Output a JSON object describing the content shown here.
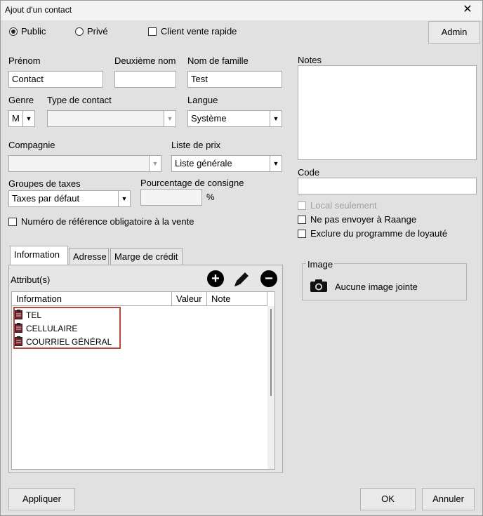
{
  "window": {
    "title": "Ajout d'un contact",
    "close_glyph": "✕"
  },
  "top": {
    "radio_public": "Public",
    "radio_prive": "Privé",
    "client_rapide": "Client vente rapide",
    "admin_button": "Admin"
  },
  "fields": {
    "prenom_label": "Prénom",
    "prenom_value": "Contact",
    "deuxieme_label": "Deuxième nom",
    "deuxieme_value": "",
    "nom_label": "Nom de famille",
    "nom_value": "Test",
    "genre_label": "Genre",
    "genre_value": "M",
    "type_label": "Type de contact",
    "type_value": "",
    "langue_label": "Langue",
    "langue_value": "Système",
    "compagnie_label": "Compagnie",
    "compagnie_value": "",
    "liste_prix_label": "Liste de prix",
    "liste_prix_value": "Liste générale",
    "groupes_taxes_label": "Groupes de taxes",
    "groupes_taxes_value": "Taxes par défaut",
    "consigne_label": "Pourcentage de consigne",
    "consigne_value": "",
    "consigne_unit": "%",
    "num_ref_label": "Numéro de référence obligatoire à la vente"
  },
  "right": {
    "notes_label": "Notes",
    "code_label": "Code",
    "local_label": "Local seulement",
    "ne_pas_envoyer_label": "Ne pas envoyer à Raange",
    "exclure_label": "Exclure du programme de loyauté",
    "image_group_label": "Image",
    "image_status": "Aucune image jointe",
    "image_icon": "camera-icon"
  },
  "tabs": [
    {
      "label": "Information"
    },
    {
      "label": "Adresse"
    },
    {
      "label": "Marge de crédit"
    }
  ],
  "attributes": {
    "label": "Attribut(s)",
    "columns": [
      "Information",
      "Valeur",
      "Note"
    ],
    "rows": [
      "TEL",
      "CELLULAIRE",
      "COURRIEL GÉNÉRAL"
    ],
    "add_glyph": "+",
    "remove_glyph": "−"
  },
  "footer": {
    "appliquer": "Appliquer",
    "ok": "OK",
    "annuler": "Annuler"
  },
  "colors": {
    "highlight_border": "#b5483d",
    "window_bg": "#e1e1e1"
  }
}
